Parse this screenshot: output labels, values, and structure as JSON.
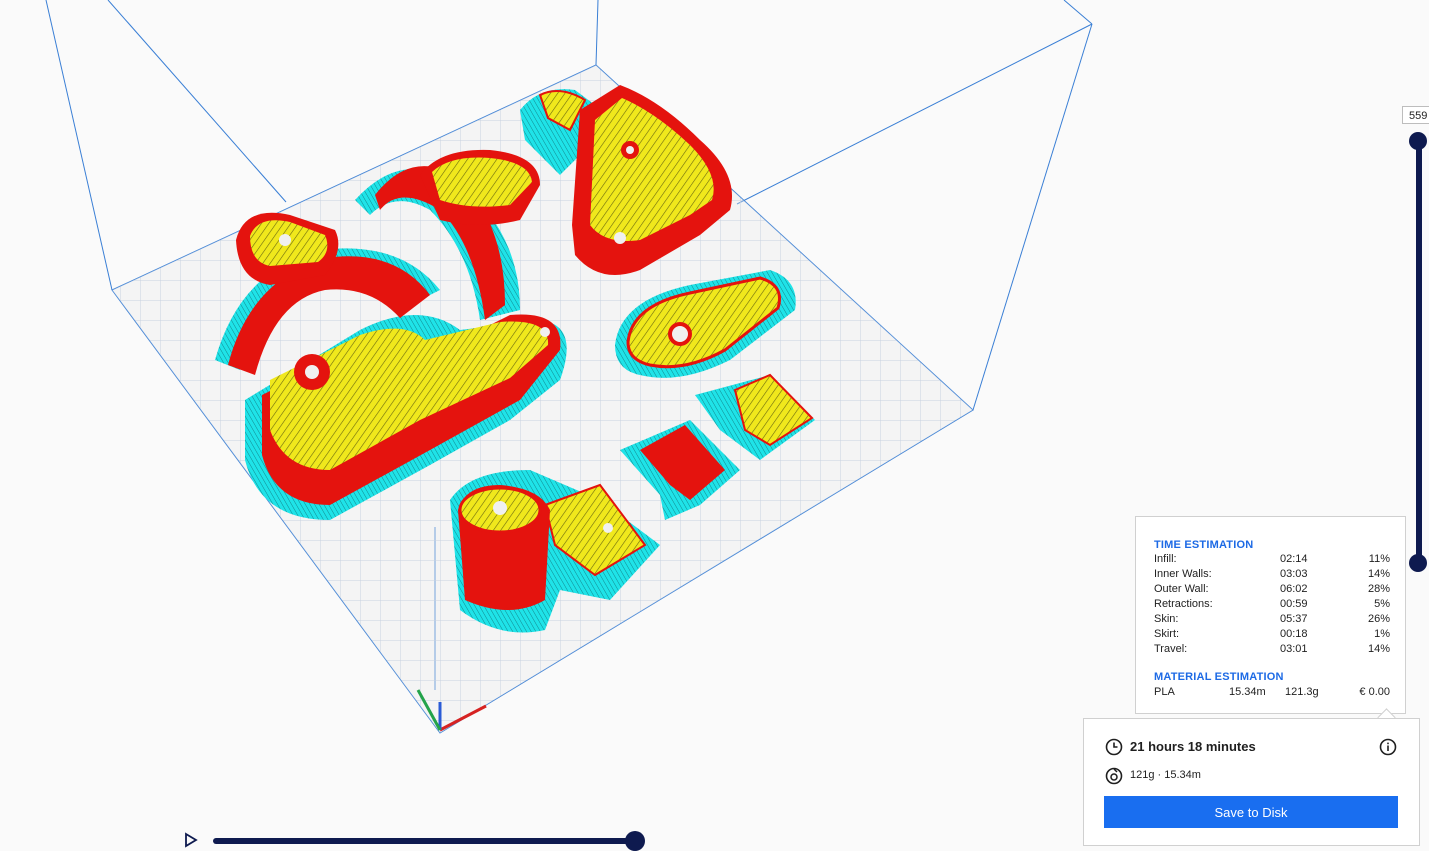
{
  "layer_view": {
    "current_layer": "559"
  },
  "time_estimation": {
    "title": "TIME ESTIMATION",
    "rows": [
      {
        "label": "Infill:",
        "time": "02:14",
        "percent": "11%"
      },
      {
        "label": "Inner Walls:",
        "time": "03:03",
        "percent": "14%"
      },
      {
        "label": "Outer Wall:",
        "time": "06:02",
        "percent": "28%"
      },
      {
        "label": "Retractions:",
        "time": "00:59",
        "percent": "5%"
      },
      {
        "label": "Skin:",
        "time": "05:37",
        "percent": "26%"
      },
      {
        "label": "Skirt:",
        "time": "00:18",
        "percent": "1%"
      },
      {
        "label": "Travel:",
        "time": "03:01",
        "percent": "14%"
      }
    ]
  },
  "material_estimation": {
    "title": "MATERIAL ESTIMATION",
    "rows": [
      {
        "material": "PLA",
        "length": "15.34m",
        "weight": "121.3g",
        "cost": "€ 0.00"
      }
    ]
  },
  "summary": {
    "print_time": "21 hours 18 minutes",
    "material": "121g · 15.34m",
    "save_label": "Save to Disk"
  },
  "colors": {
    "accent": "#196ef0",
    "slider": "#0e1a4f",
    "section_title": "#1d6ae5",
    "walls": "#e4130e",
    "skin": "#f0e81c",
    "skirt": "#1fe3e8",
    "build_volume": "#3a7fd5"
  },
  "icons": {
    "clock": "clock-icon",
    "spool": "spool-icon",
    "info": "info-icon",
    "play": "play-icon"
  }
}
